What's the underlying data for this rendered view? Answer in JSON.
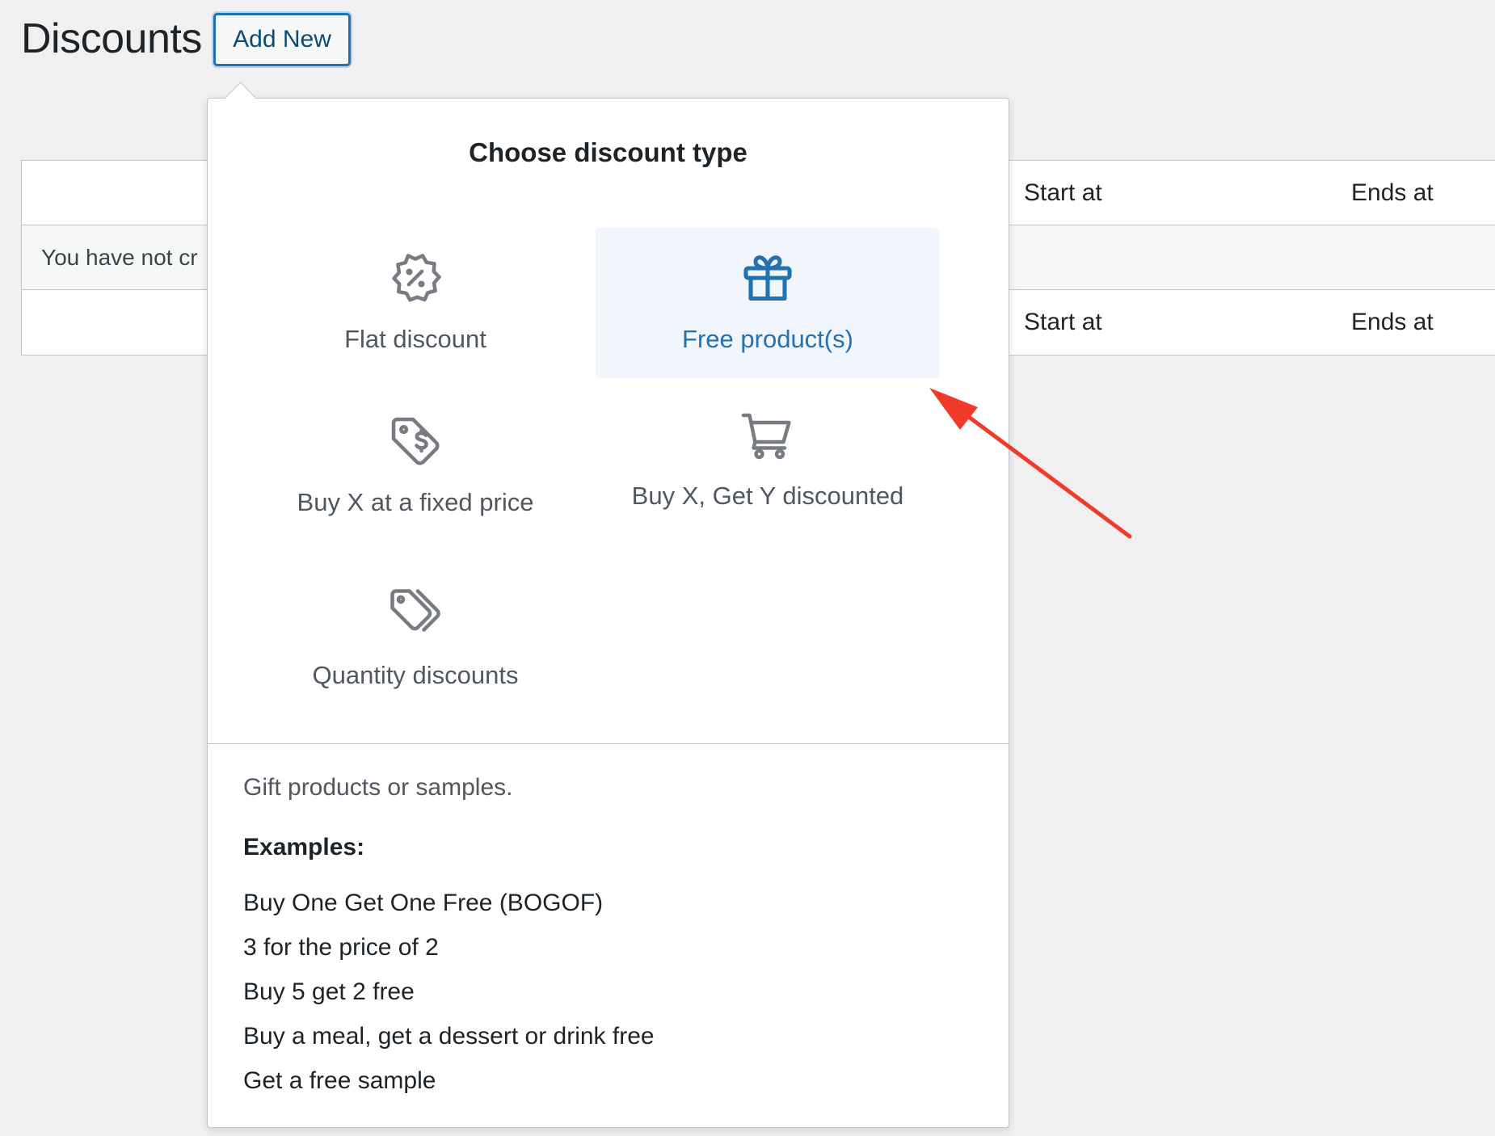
{
  "header": {
    "title": "Discounts",
    "add_new_label": "Add New"
  },
  "table": {
    "columns": [
      "Start at",
      "Ends at"
    ],
    "empty_message": "You have not cr",
    "footer_columns": [
      "Start at",
      "Ends at"
    ]
  },
  "popover": {
    "title": "Choose discount type",
    "options": [
      {
        "label": "Flat discount",
        "icon": "percent-badge-icon",
        "selected": false
      },
      {
        "label": "Free product(s)",
        "icon": "gift-icon",
        "selected": true
      },
      {
        "label": "Buy X at a fixed price",
        "icon": "dollar-tag-icon",
        "selected": false
      },
      {
        "label": "Buy X, Get Y discounted",
        "icon": "cart-icon",
        "selected": false
      },
      {
        "label": "Quantity discounts",
        "icon": "tags-icon",
        "selected": false
      }
    ],
    "description": "Gift products or samples.",
    "examples_heading": "Examples:",
    "examples": [
      "Buy One Get One Free (BOGOF)",
      "3 for the price of 2",
      "Buy 5 get 2 free",
      "Buy a meal, get a dessert or drink free",
      "Get a free sample"
    ]
  },
  "colors": {
    "accent": "#2271b1",
    "annotation_arrow": "#f03a2a",
    "selected_bg": "#f0f6fc"
  }
}
